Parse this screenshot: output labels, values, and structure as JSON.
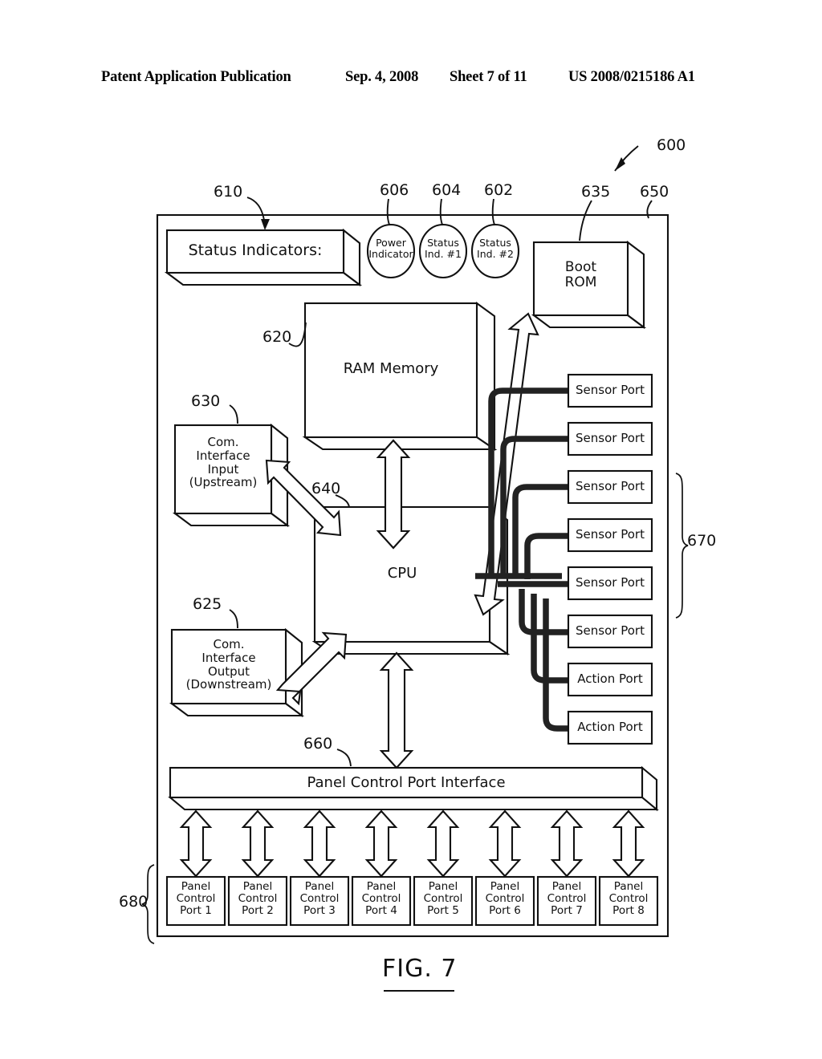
{
  "header": {
    "publication": "Patent Application Publication",
    "date": "Sep. 4, 2008",
    "sheet": "Sheet 7 of 11",
    "patent_number": "US 2008/0215186 A1"
  },
  "figure": {
    "caption": "FIG. 7",
    "system_ref": "600",
    "enclosure_ref": "650"
  },
  "blocks": {
    "status_indicators": {
      "label": "Status Indicators:",
      "ref": "610"
    },
    "power_indicator": {
      "label": "Power\nIndicator",
      "ref": "606"
    },
    "status_ind_1": {
      "label": "Status\nInd. #1",
      "ref": "604"
    },
    "status_ind_2": {
      "label": "Status\nInd. #2",
      "ref": "602"
    },
    "boot_rom": {
      "label": "Boot\nROM",
      "ref": "635"
    },
    "ram_memory": {
      "label": "RAM Memory",
      "ref": "620"
    },
    "com_interface_input": {
      "label": "Com.\nInterface\nInput\n(Upstream)",
      "ref": "630"
    },
    "com_interface_output": {
      "label": "Com.\nInterface\nOutput\n(Downstream)",
      "ref": "625"
    },
    "cpu": {
      "label": "CPU",
      "ref": "640"
    },
    "panel_control_port_interface": {
      "label": "Panel Control Port Interface",
      "ref": "660"
    }
  },
  "ports": {
    "io_ports_ref": "670",
    "io_ports": [
      {
        "label": "Sensor Port"
      },
      {
        "label": "Sensor Port"
      },
      {
        "label": "Sensor Port"
      },
      {
        "label": "Sensor Port"
      },
      {
        "label": "Sensor Port"
      },
      {
        "label": "Sensor Port"
      },
      {
        "label": "Action Port"
      },
      {
        "label": "Action Port"
      }
    ],
    "panel_ports_ref": "680",
    "panel_ports": [
      {
        "label": "Panel\nControl\nPort 1"
      },
      {
        "label": "Panel\nControl\nPort 2"
      },
      {
        "label": "Panel\nControl\nPort 3"
      },
      {
        "label": "Panel\nControl\nPort 4"
      },
      {
        "label": "Panel\nControl\nPort 5"
      },
      {
        "label": "Panel\nControl\nPort 6"
      },
      {
        "label": "Panel\nControl\nPort 7"
      },
      {
        "label": "Panel\nControl\nPort 8"
      }
    ]
  },
  "colors": {
    "ink": "#111111",
    "paper": "#ffffff",
    "cable": "#222222"
  }
}
